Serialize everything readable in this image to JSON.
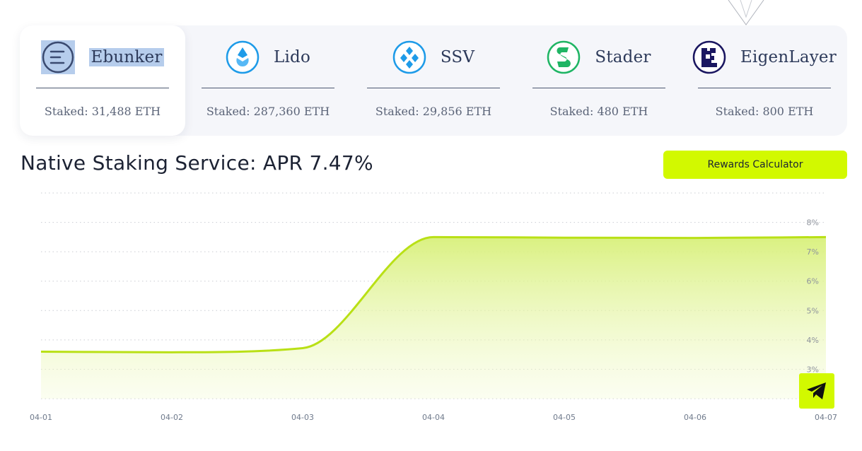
{
  "providers": [
    {
      "name": "Ebunker",
      "staked": "Staked: 31,488 ETH",
      "icon": "ebunker-icon",
      "active": true
    },
    {
      "name": "Lido",
      "staked": "Staked: 287,360 ETH",
      "icon": "lido-icon",
      "active": false
    },
    {
      "name": "SSV",
      "staked": "Staked: 29,856 ETH",
      "icon": "ssv-icon",
      "active": false
    },
    {
      "name": "Stader",
      "staked": "Staked: 480 ETH",
      "icon": "stader-icon",
      "active": false
    },
    {
      "name": "EigenLayer",
      "staked": "Staked: 800 ETH",
      "icon": "eigenlayer-icon",
      "active": false
    }
  ],
  "title": "Native Staking Service: APR 7.47%",
  "rewards_button": "Rewards Calculator",
  "telegram_icon": "telegram-icon",
  "colors": {
    "accent": "#d2f900",
    "line": "#b9e016",
    "selection": "#b6cdec"
  },
  "chart_data": {
    "type": "area",
    "x": [
      "04-01",
      "04-02",
      "04-03",
      "04-04",
      "04-05",
      "04-06",
      "04-07"
    ],
    "series": [
      {
        "values": [
          3.6,
          3.58,
          3.72,
          7.5,
          7.48,
          7.47,
          7.5
        ]
      }
    ],
    "xticks": [
      "04-01",
      "04-02",
      "04-03",
      "04-04",
      "04-05",
      "04-06",
      "04-07"
    ],
    "yticks": [
      "3%",
      "4%",
      "5%",
      "6%",
      "7%",
      "8%"
    ],
    "ylim": [
      2,
      9
    ],
    "y_axis_position": "right",
    "grid": "dotted-horizontal",
    "legend": "none"
  }
}
